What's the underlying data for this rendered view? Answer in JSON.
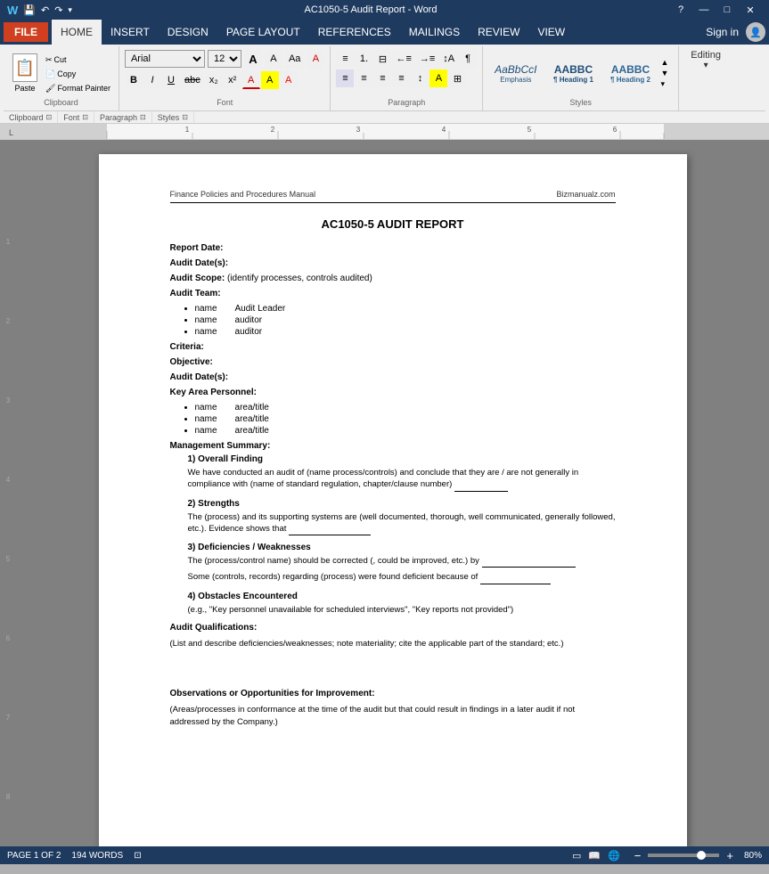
{
  "titlebar": {
    "title": "AC1050-5 Audit Report - Word",
    "help_icon": "?",
    "minimize": "—",
    "maximize": "□",
    "close": "✕"
  },
  "menubar": {
    "file_btn": "FILE",
    "tabs": [
      "HOME",
      "INSERT",
      "DESIGN",
      "PAGE LAYOUT",
      "REFERENCES",
      "MAILINGS",
      "REVIEW",
      "VIEW"
    ],
    "active_tab": "HOME",
    "sign_in": "Sign in"
  },
  "ribbon": {
    "clipboard_label": "Clipboard",
    "paste_label": "Paste",
    "cut_label": "Cut",
    "copy_label": "Copy",
    "format_painter_label": "Format Painter",
    "font_label": "Font",
    "font_name": "Arial",
    "font_size": "12",
    "paragraph_label": "Paragraph",
    "styles_label": "Styles",
    "styles": [
      {
        "name": "Emphasis",
        "style": "italic"
      },
      {
        "name": "¶ Heading 1",
        "style": "bold"
      },
      {
        "name": "¶ Heading 2",
        "style": "bold"
      }
    ],
    "editing_label": "Editing"
  },
  "document": {
    "header_left": "Finance Policies and Procedures Manual",
    "header_right": "Bizmanualz.com",
    "title": "AC1050-5 AUDIT REPORT",
    "report_date_label": "Report Date:",
    "audit_dates_label": "Audit Date(s):",
    "audit_scope_label": "Audit Scope:",
    "audit_scope_value": "(identify processes, controls audited)",
    "audit_team_label": "Audit Team:",
    "audit_team_members": [
      {
        "name": "name",
        "role": "Audit Leader"
      },
      {
        "name": "name",
        "role": "auditor"
      },
      {
        "name": "name",
        "role": "auditor"
      }
    ],
    "criteria_label": "Criteria:",
    "objective_label": "Objective:",
    "audit_dates2_label": "Audit Date(s):",
    "key_personnel_label": "Key Area Personnel:",
    "key_personnel": [
      {
        "name": "name",
        "role": "area/title"
      },
      {
        "name": "name",
        "role": "area/title"
      },
      {
        "name": "name",
        "role": "area/title"
      }
    ],
    "mgmt_summary_label": "Management Summary:",
    "sections": [
      {
        "number": "1)",
        "title": "Overall Finding",
        "text": "We have conducted an audit of (name process/controls) and conclude that they are / are not generally in compliance with (name of standard regulation, chapter/clause number)"
      },
      {
        "number": "2)",
        "title": "Strengths",
        "text": "The (process) and its supporting systems are (well documented, thorough, well communicated, generally followed, etc.).  Evidence shows that"
      },
      {
        "number": "3)",
        "title": "Deficiencies / Weaknesses",
        "lines": [
          "The (process/control name) should be corrected (, could be improved, etc.) by",
          "Some (controls, records) regarding (process) were found deficient because of"
        ]
      },
      {
        "number": "4)",
        "title": "Obstacles Encountered",
        "text": "(e.g., \"Key personnel unavailable for scheduled interviews\", \"Key reports not provided\")"
      }
    ],
    "audit_qual_label": "Audit Qualifications:",
    "audit_qual_text": "(List and describe deficiencies/weaknesses; note materiality; cite the applicable part of the standard; etc.)",
    "observations_label": "Observations or Opportunities for Improvement:",
    "observations_text": "(Areas/processes in conformance at the time of the audit but that could result in findings in a later audit if not addressed by the Company.)"
  },
  "statusbar": {
    "page_info": "PAGE 1 OF 2",
    "word_count": "194 WORDS",
    "zoom": "80%",
    "zoom_minus": "−",
    "zoom_plus": "+"
  }
}
